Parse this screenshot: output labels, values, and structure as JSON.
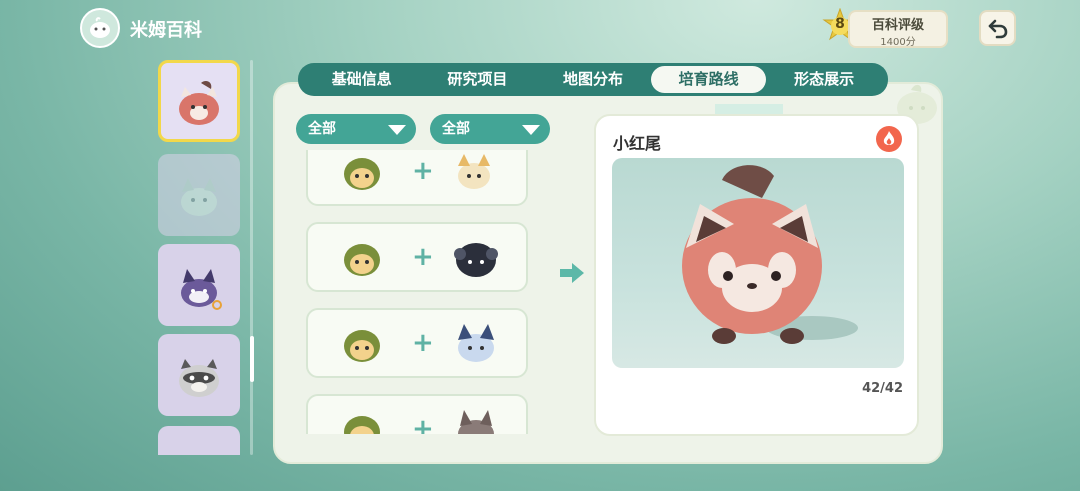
{
  "app": {
    "title": "米姆百科"
  },
  "rank": {
    "level": "8",
    "title": "百科评级",
    "score": "1400分"
  },
  "tabs": [
    {
      "label": "基础信息",
      "active": false
    },
    {
      "label": "研究项目",
      "active": false
    },
    {
      "label": "地图分布",
      "active": false
    },
    {
      "label": "培育路线",
      "active": true
    },
    {
      "label": "形态展示",
      "active": false
    }
  ],
  "filters": {
    "left_value": "全部",
    "right_value": "全部"
  },
  "result": {
    "name": "小红尾",
    "count": "42/42"
  },
  "colors": {
    "accent": "#2e7f74",
    "filter": "#43a596",
    "fire": "#f2664d",
    "active_border": "#f2d84a"
  },
  "icons": {
    "back": "back-arrow-icon",
    "fire": "fire-icon",
    "app": "app-icon"
  }
}
